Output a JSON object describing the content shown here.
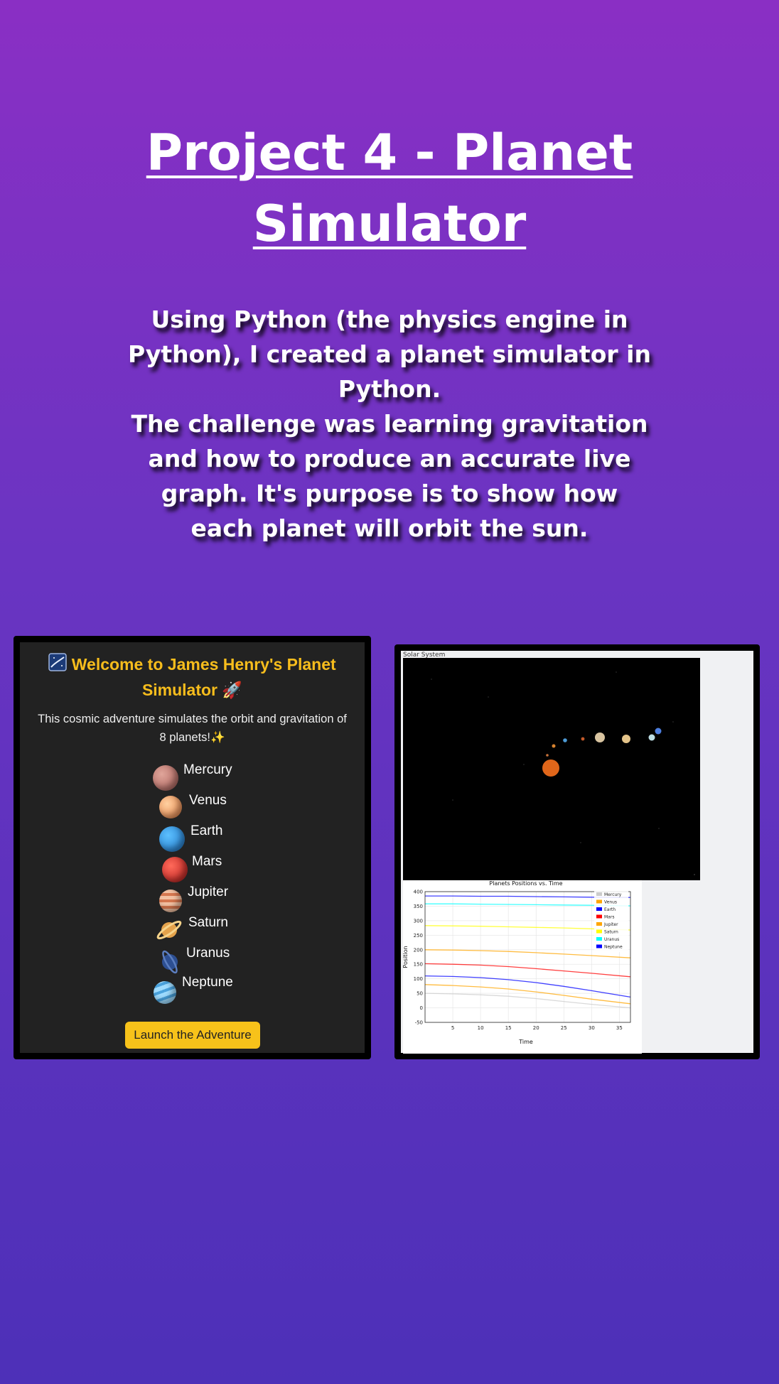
{
  "page": {
    "title": "Project 4 - Planet Simulator",
    "description": [
      "Using Python (the physics engine in Python), I created a planet simulator in Python.",
      "The challenge was learning gravitation and how to produce an accurate live graph. It's purpose is to show how each planet will orbit the sun."
    ]
  },
  "simulator_welcome": {
    "title_icon": "milky-way-icon",
    "title": "Welcome to James Henry's Planet Simulator",
    "title_trailing_icon": "rocket-icon",
    "title_trailing_glyph": "🚀",
    "intro": "This cosmic adventure simulates the orbit and gravitation of 8 planets!",
    "intro_trailing_glyph": "✨",
    "planets": [
      {
        "name": "Mercury",
        "icon": "mercury-icon",
        "color": "#b8706a"
      },
      {
        "name": "Venus",
        "icon": "venus-icon",
        "color": "#e8935a"
      },
      {
        "name": "Earth",
        "icon": "earth-icon",
        "color": "#2f8fd6"
      },
      {
        "name": "Mars",
        "icon": "mars-icon",
        "color": "#d0302a"
      },
      {
        "name": "Jupiter",
        "icon": "jupiter-icon",
        "color": "#d98a6a"
      },
      {
        "name": "Saturn",
        "icon": "saturn-icon",
        "color": "#e0a24a"
      },
      {
        "name": "Uranus",
        "icon": "uranus-icon",
        "color": "#3a5fa8"
      },
      {
        "name": "Neptune",
        "icon": "neptune-icon",
        "color": "#6cb8e8"
      }
    ],
    "launch_button": "Launch the Adventure",
    "accent_color": "#f7bd1c"
  },
  "simulation_window": {
    "label": "Solar System",
    "bodies": [
      {
        "name": "Sun",
        "color": "#e0661a"
      },
      {
        "name": "Mercury",
        "color": "#c9733a"
      },
      {
        "name": "Venus",
        "color": "#d7832f"
      },
      {
        "name": "Earth",
        "color": "#4d9bd6"
      },
      {
        "name": "Mars",
        "color": "#c45a2a"
      },
      {
        "name": "Jupiter",
        "color": "#d8c4a0"
      },
      {
        "name": "Saturn",
        "color": "#e4c48a"
      },
      {
        "name": "Uranus",
        "color": "#bcdde4"
      },
      {
        "name": "Neptune",
        "color": "#4d7fe0"
      }
    ]
  },
  "chart_data": {
    "type": "line",
    "title": "Planets Positions vs. Time",
    "xlabel": "Time",
    "ylabel": "Position",
    "xlim": [
      0,
      37
    ],
    "ylim": [
      -50,
      400
    ],
    "xticks": [
      5,
      10,
      15,
      20,
      25,
      30,
      35
    ],
    "yticks": [
      -50,
      0,
      50,
      100,
      150,
      200,
      250,
      300,
      350,
      400
    ],
    "grid": true,
    "legend_position": "top-right",
    "x": [
      0,
      5,
      10,
      15,
      20,
      25,
      30,
      37
    ],
    "series": [
      {
        "name": "Mercury",
        "color": "#cccccc",
        "values": [
          50,
          48,
          45,
          40,
          32,
          22,
          12,
          0
        ]
      },
      {
        "name": "Venus",
        "color": "#ffa500",
        "values": [
          80,
          77,
          72,
          65,
          55,
          43,
          30,
          14
        ]
      },
      {
        "name": "Earth",
        "color": "#0000ff",
        "values": [
          110,
          108,
          104,
          97,
          87,
          74,
          59,
          37
        ]
      },
      {
        "name": "Mars",
        "color": "#ff0000",
        "values": [
          152,
          150,
          147,
          142,
          135,
          127,
          119,
          107
        ]
      },
      {
        "name": "Jupiter",
        "color": "#ffa500",
        "values": [
          200,
          199,
          197,
          194,
          190,
          185,
          180,
          172
        ]
      },
      {
        "name": "Saturn",
        "color": "#ffff00",
        "values": [
          283,
          282,
          281,
          279,
          277,
          275,
          272,
          268
        ]
      },
      {
        "name": "Uranus",
        "color": "#00ffff",
        "values": [
          358,
          358,
          357,
          356,
          355,
          354,
          353,
          351
        ]
      },
      {
        "name": "Neptune",
        "color": "#0000ff",
        "values": [
          385,
          385,
          384,
          384,
          383,
          382,
          381,
          380
        ]
      }
    ]
  }
}
